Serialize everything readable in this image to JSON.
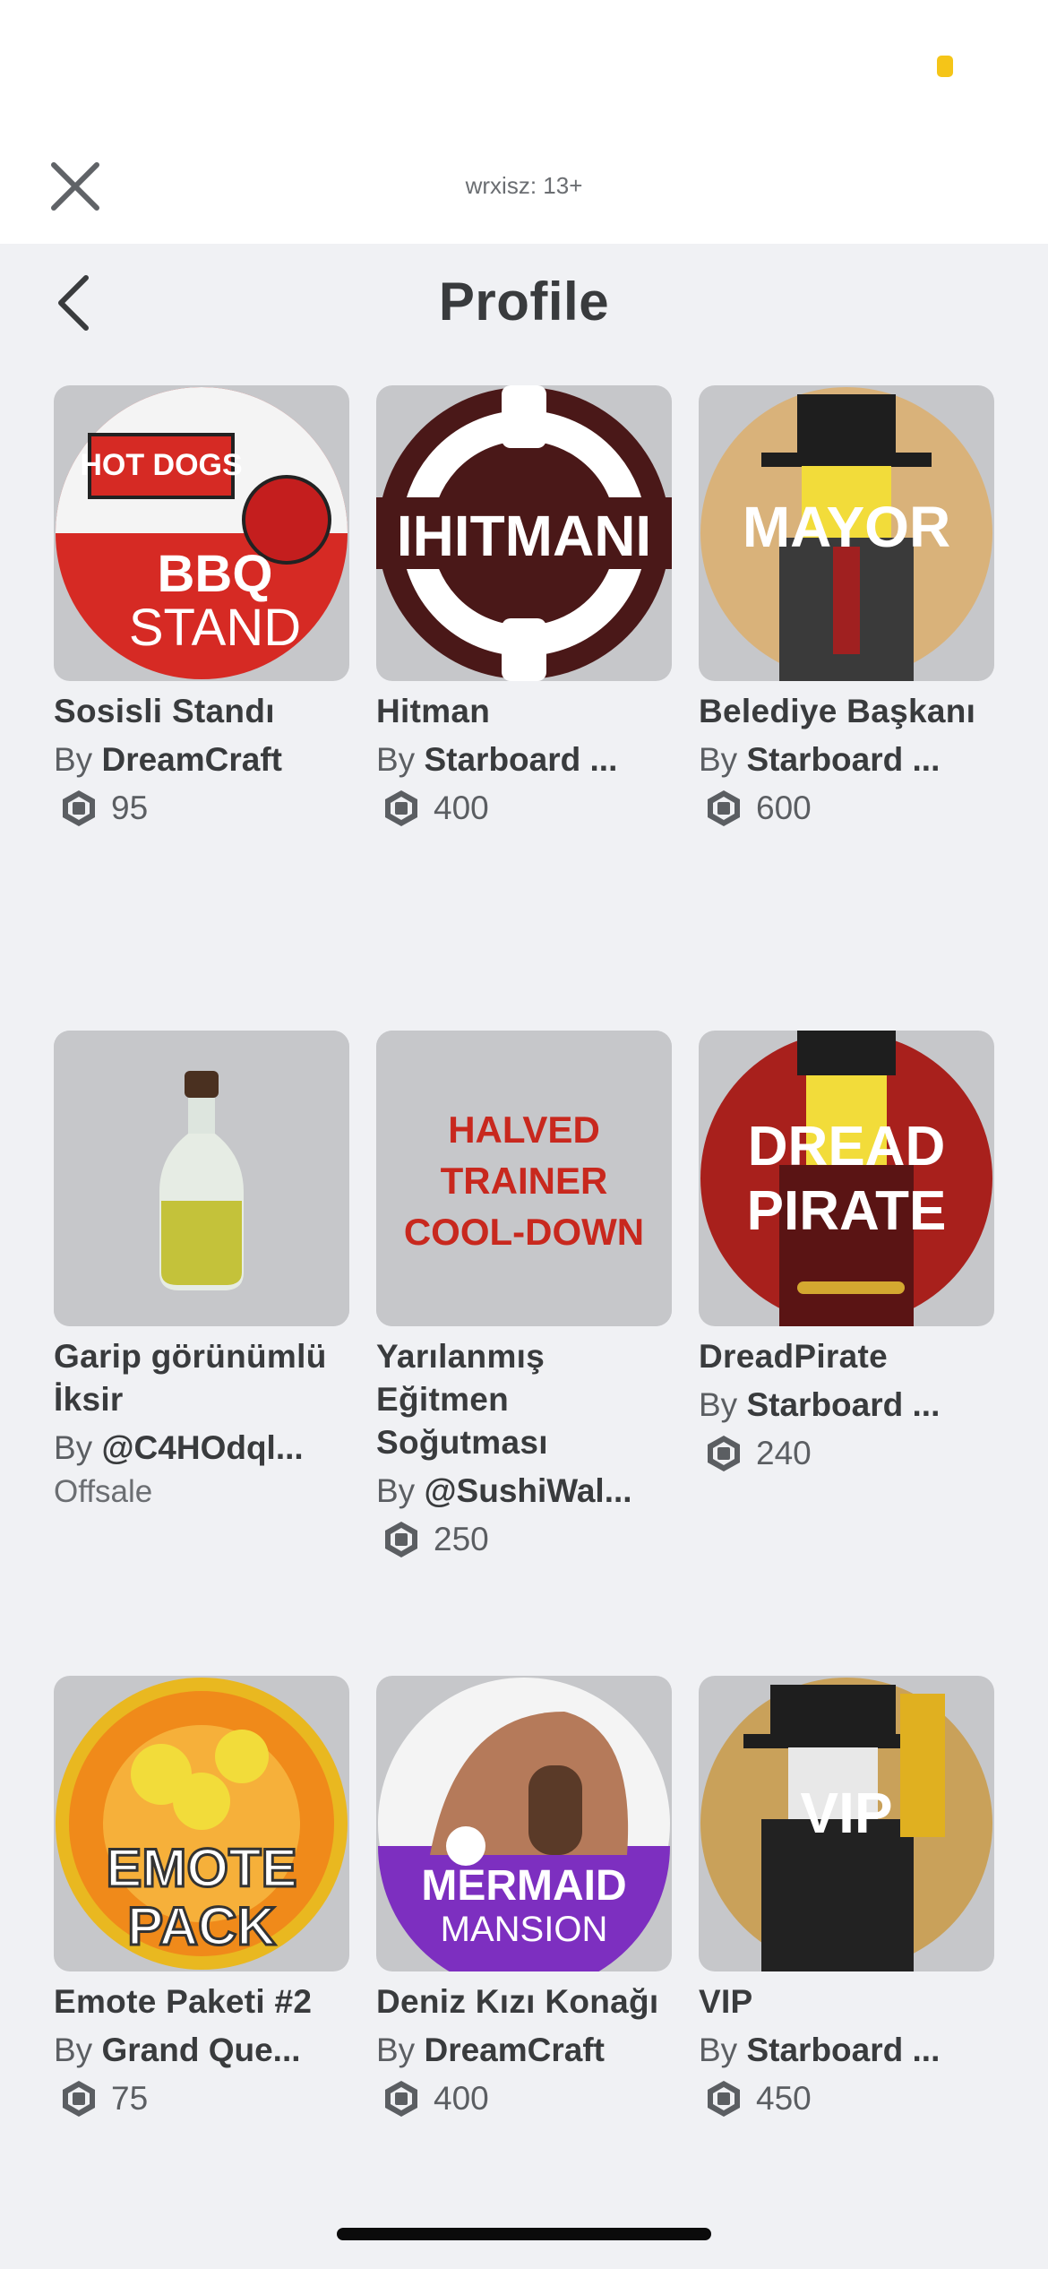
{
  "topbar": {
    "site_label": "wrxisz: 13+",
    "accent_color": "#f5c518"
  },
  "header": {
    "title": "Profile",
    "back_icon": "chevron-left-icon",
    "close_icon": "close-icon"
  },
  "items": [
    {
      "name": "Sosisli Standı",
      "by": "By",
      "creator": "DreamCraft",
      "price": "95",
      "thumb_text": "BBQ STAND",
      "thumb_top": "HOT DOGS"
    },
    {
      "name": "Hitman",
      "by": "By",
      "creator": "Starboard ...",
      "price": "400",
      "thumb_text": "IHITMANI"
    },
    {
      "name": "Belediye Başkanı",
      "by": "By",
      "creator": "Starboard ...",
      "price": "600",
      "thumb_text": "MAYOR"
    },
    {
      "name": "Garip görünümlü İksir",
      "by": "By",
      "creator": "@C4HOdql...",
      "status": "Offsale"
    },
    {
      "name": "Yarılanmış Eğitmen Soğutması",
      "by": "By",
      "creator": "@SushiWal...",
      "price": "250",
      "thumb_lines": [
        "HALVED",
        "TRAINER",
        "COOL-DOWN"
      ]
    },
    {
      "name": "DreadPirate",
      "by": "By",
      "creator": "Starboard ...",
      "price": "240",
      "thumb_lines": [
        "DREAD",
        "PIRATE"
      ]
    },
    {
      "name": "Emote Paketi #2",
      "by": "By",
      "creator": "Grand Que...",
      "price": "75",
      "thumb_lines": [
        "EMOTE",
        "PACK"
      ]
    },
    {
      "name": "Deniz Kızı Konağı",
      "by": "By",
      "creator": "DreamCraft",
      "price": "400",
      "thumb_lines": [
        "MERMAID",
        "MANSION"
      ]
    },
    {
      "name": "VIP",
      "by": "By",
      "creator": "Starboard ...",
      "price": "450",
      "thumb_text": "VIP"
    }
  ]
}
